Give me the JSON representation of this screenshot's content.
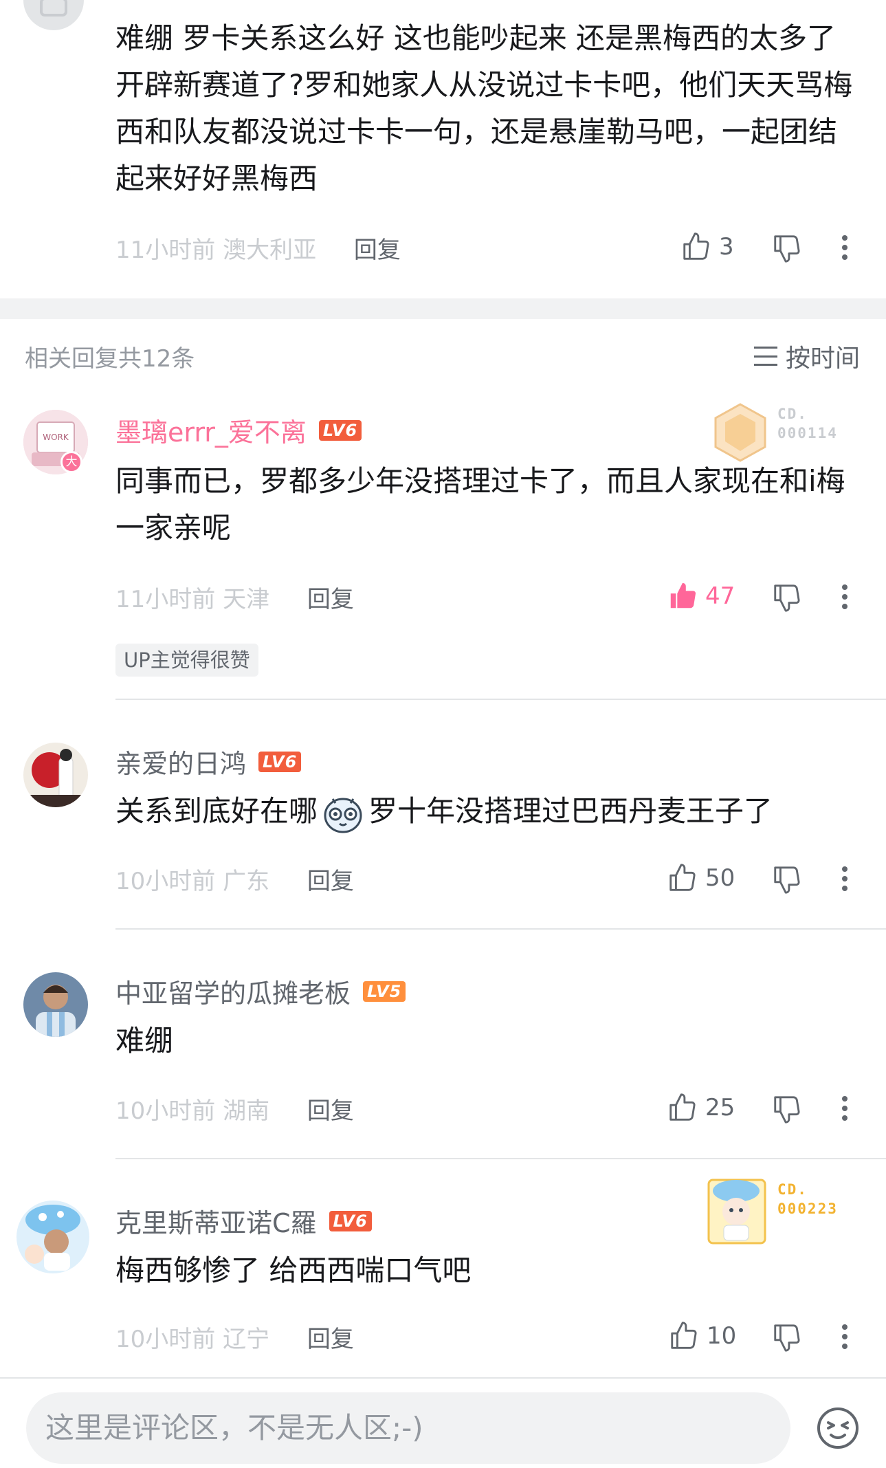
{
  "root": {
    "text": "难绷 罗卡关系这么好 这也能吵起来 还是黑梅西的太多了 开辟新赛道了?罗和她家人从没说过卡卡吧，他们天天骂梅西和队友都没说过卡卡一句，还是悬崖勒马吧，一起团结起来好好黑梅西",
    "time": "11小时前",
    "location": "澳大利亚",
    "reply_label": "回复",
    "likes": "3"
  },
  "section": {
    "title": "相关回复共12条",
    "sort_label": "按时间"
  },
  "comments": [
    {
      "username": "墨璃errr_爱不离",
      "level": "LV6",
      "text": "同事而已，罗都多少年没搭理过卡了，而且人家现在和i梅一家亲呢",
      "time": "11小时前",
      "location": "天津",
      "reply_label": "回复",
      "likes": "47",
      "liked": true,
      "badge": "UP主觉得很赞",
      "card_no": "CD.\n000114",
      "avatar_badge": "大"
    },
    {
      "username": "亲爱的日鸿",
      "level": "LV6",
      "text_before": "关系到底好在哪",
      "text_after": "罗十年没搭理过巴西丹麦王子了",
      "time": "10小时前",
      "location": "广东",
      "reply_label": "回复",
      "likes": "50"
    },
    {
      "username": "中亚留学的瓜摊老板",
      "level": "LV5",
      "text": "难绷",
      "time": "10小时前",
      "location": "湖南",
      "reply_label": "回复",
      "likes": "25"
    },
    {
      "username": "克里斯蒂亚诺C羅",
      "level": "LV6",
      "text": "梅西够惨了 给西西喘口气吧",
      "time": "10小时前",
      "location": "辽宁",
      "reply_label": "回复",
      "likes": "10",
      "card_no": "CD.\n000223"
    }
  ],
  "input": {
    "placeholder": "这里是评论区，不是无人区;-)"
  },
  "colors": {
    "pink": "#fb7299",
    "like_active": "#ff6699",
    "lv6": "#f25d3c",
    "lv5": "#ff8f3c",
    "text_primary": "#18191c",
    "text_secondary": "#61666d",
    "text_tertiary": "#9499a0",
    "meta": "#c9ccd0"
  },
  "icons": [
    "thumb-up-icon",
    "thumb-down-icon",
    "more-icon",
    "sort-icon",
    "emoji-icon"
  ]
}
